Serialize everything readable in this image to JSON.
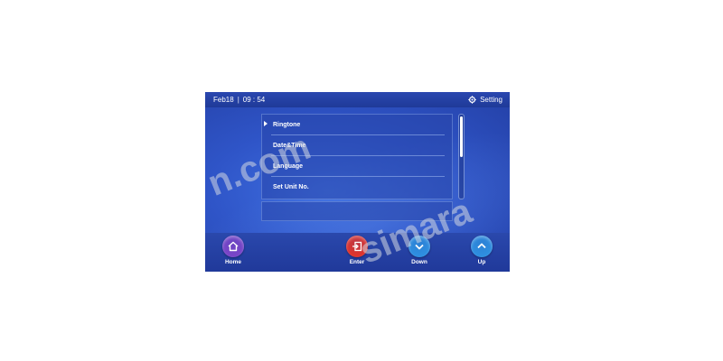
{
  "status_bar": {
    "date": "Feb18",
    "separator": "|",
    "time": "09 : 54",
    "icon": "gear-icon",
    "title": "Setting"
  },
  "menu": {
    "selected_index": 0,
    "items": [
      {
        "label": "Ringtone"
      },
      {
        "label": "Date&Time"
      },
      {
        "label": "Language"
      },
      {
        "label": "Set Unit No."
      }
    ]
  },
  "scrollbar": {
    "visible_fraction": 0.5,
    "position": 0
  },
  "bottom_bar": {
    "buttons": [
      {
        "label": "Home",
        "icon": "home-icon",
        "color": "#7a45c8"
      },
      {
        "label": "Enter",
        "icon": "enter-icon",
        "color": "#e0342c"
      },
      {
        "label": "Down",
        "icon": "chevron-down-icon",
        "color": "#2e8fe0"
      },
      {
        "label": "Up",
        "icon": "chevron-up-icon",
        "color": "#2e8fe0"
      }
    ]
  },
  "watermark": {
    "texts": [
      "n.com",
      "simara"
    ]
  },
  "colors": {
    "screen_bg": "#2f55c8",
    "status_bar_bg": "#1f3a98",
    "text": "#ffffff"
  }
}
